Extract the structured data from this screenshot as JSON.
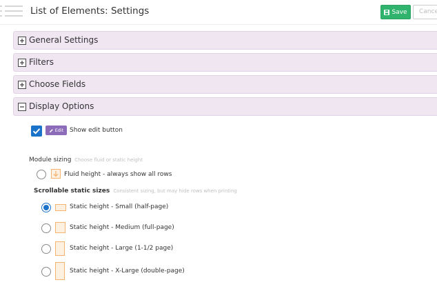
{
  "header": {
    "title": "List of Elements: Settings",
    "save_label": "Save",
    "cancel_label": "Cancel"
  },
  "panels": [
    {
      "label": "General Settings",
      "expanded": false
    },
    {
      "label": "Filters",
      "expanded": false
    },
    {
      "label": "Choose Fields",
      "expanded": false
    },
    {
      "label": "Display Options",
      "expanded": true
    }
  ],
  "display_options": {
    "show_edit": {
      "checked": true,
      "badge_label": "Edit",
      "label": "Show edit button"
    },
    "module_sizing": {
      "label": "Module sizing",
      "hint": "Choose fluid or static height"
    },
    "fluid": {
      "label": "Fluid height - always show all rows",
      "selected": false
    },
    "scrollable": {
      "label": "Scrollable static sizes",
      "hint": "Consistent sizing, but may hide rows when printing"
    },
    "static_sizes": [
      {
        "label": "Static height - Small (half-page)",
        "selected": true
      },
      {
        "label": "Static height - Medium (full-page)",
        "selected": false
      },
      {
        "label": "Static height - Large (1-1/2 page)",
        "selected": false
      },
      {
        "label": "Static height - X-Large (double-page)",
        "selected": false
      }
    ]
  },
  "colors": {
    "save": "#2fb36d",
    "panel_bg": "#efe6f2",
    "checkbox": "#1a73c9",
    "edit_badge": "#8c6bb8",
    "size_icon": "#f4b46e"
  }
}
